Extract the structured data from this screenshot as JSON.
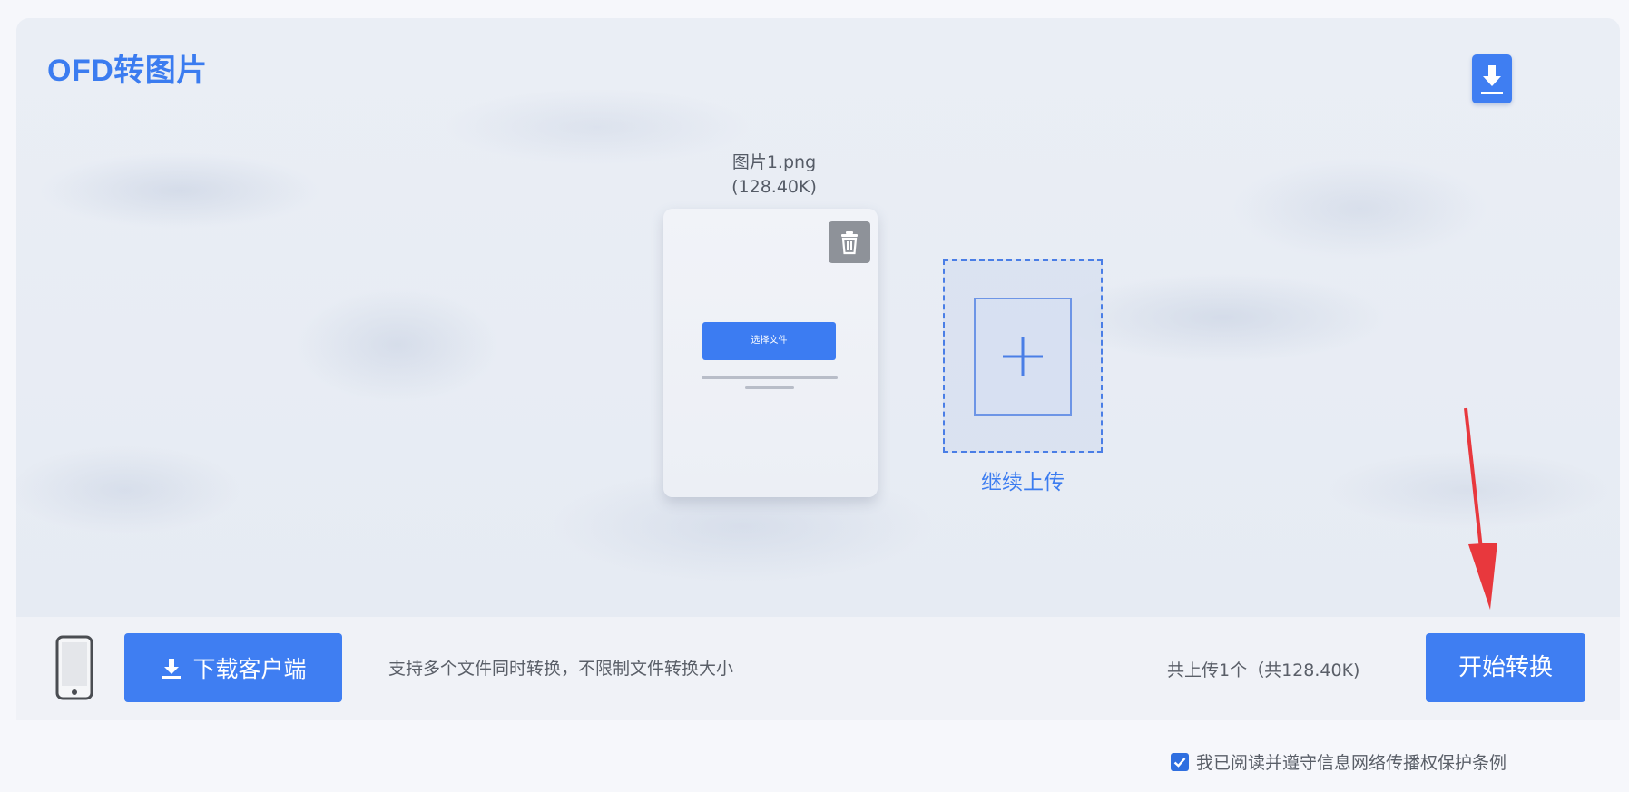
{
  "header": {
    "title": "OFD转图片",
    "download_icon": "download-icon"
  },
  "file": {
    "name": "图片1.png",
    "size": "(128.40K)",
    "thumbnail_button_label": "选择文件",
    "delete_icon": "trash-icon"
  },
  "upload_more": {
    "icon": "plus-icon",
    "label": "继续上传"
  },
  "footer": {
    "phone_icon": "smartphone-icon",
    "download_client_label": "下载客户端",
    "support_text": "支持多个文件同时转换，不限制文件转换大小",
    "upload_count": "共上传1个（共128.40K)",
    "start_label": "开始转换"
  },
  "agreement": {
    "checked": true,
    "label": "我已阅读并遵守信息网络传播权保护条例"
  },
  "colors": {
    "accent": "#3f7ef2",
    "annotation_arrow": "#e8383d"
  }
}
